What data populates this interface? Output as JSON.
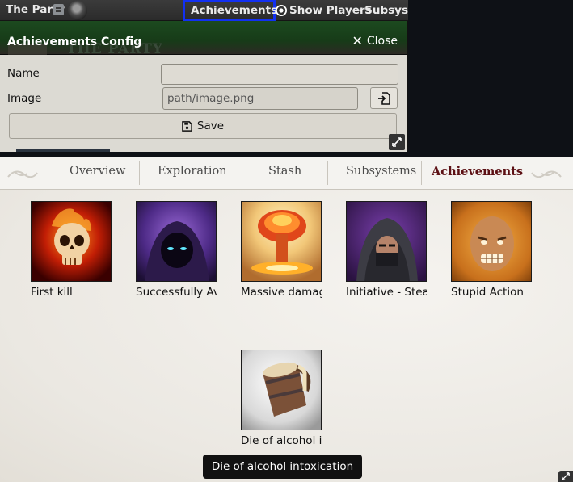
{
  "header": {
    "actor_name": "The Party",
    "buttons": {
      "achievements": "Achievements",
      "show_players": "Show Players",
      "subsystems": "Subsys"
    }
  },
  "dialog": {
    "title": "Achievements Config",
    "close_label": "Close",
    "name_label": "Name",
    "name_value": "",
    "image_label": "Image",
    "image_value": "path/image.png",
    "save_label": "Save",
    "background_text": "THE PARTY"
  },
  "tabs": [
    {
      "label": "Overview",
      "active": false
    },
    {
      "label": "Exploration",
      "active": false
    },
    {
      "label": "Stash",
      "active": false
    },
    {
      "label": "Subsystems",
      "active": false
    },
    {
      "label": "Achievements",
      "active": true
    }
  ],
  "achievements": [
    {
      "label": "First kill",
      "icon": "flaming-skull-icon"
    },
    {
      "label": "Successfully Avoided",
      "icon": "hooded-figure-icon"
    },
    {
      "label": "Massive damage",
      "icon": "nuclear-explosion-icon"
    },
    {
      "label": "Initiative - Stealth",
      "icon": "masked-rogue-icon"
    },
    {
      "label": "Stupid Action",
      "icon": "screaming-face-icon"
    },
    {
      "label": "Die of alcohol intoxication",
      "icon": "beer-mug-icon"
    }
  ],
  "tooltip": "Die of alcohol intoxication",
  "colors": {
    "header_bg": "#2f2f2f",
    "highlight_border": "#1230f2",
    "dialog_title_bg": "#1c4a1f",
    "dialog_body_bg": "#dcdad3",
    "active_tab": "#5c1014"
  }
}
